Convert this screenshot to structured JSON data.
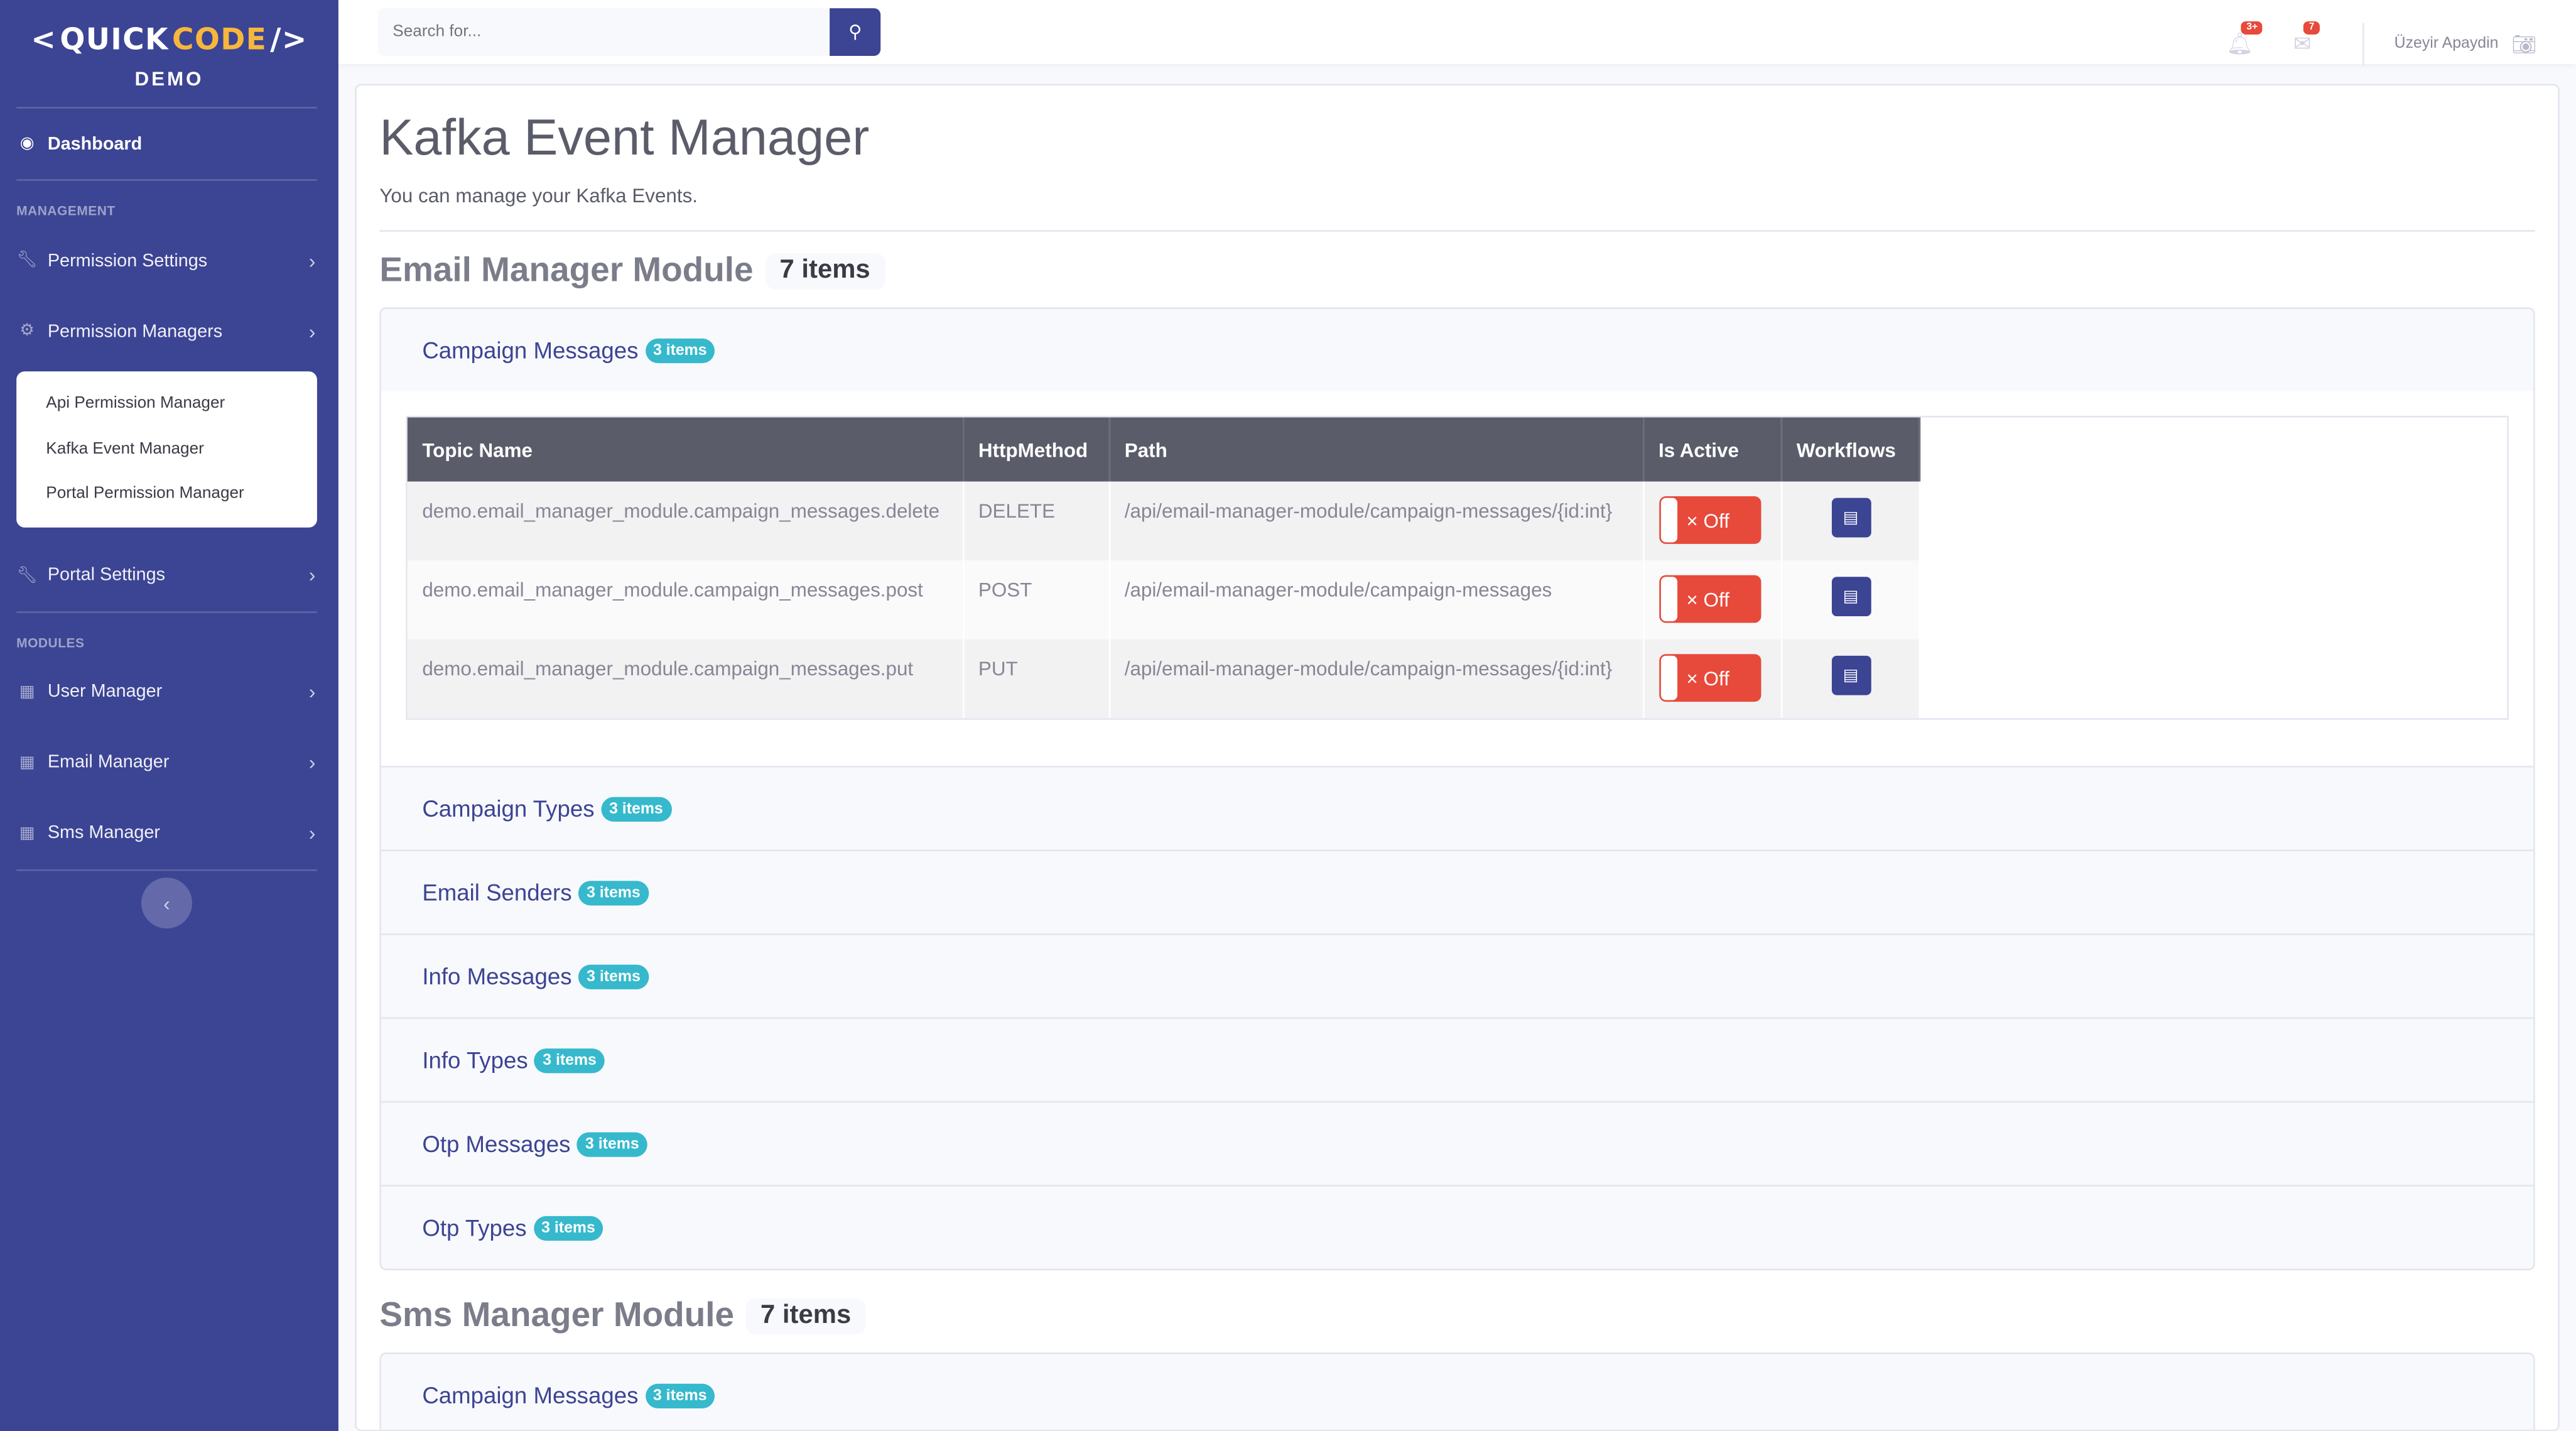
{
  "brand": {
    "left": "<",
    "quick": "QUICK",
    "code": "CODE",
    "right": "/>",
    "sub": "DEMO"
  },
  "sidebar": {
    "dashboard": "Dashboard",
    "heading_management": "MANAGEMENT",
    "permission_settings": "Permission Settings",
    "permission_managers": "Permission Managers",
    "submenu": [
      "Api Permission Manager",
      "Kafka Event Manager",
      "Portal Permission Manager"
    ],
    "portal_settings": "Portal Settings",
    "heading_modules": "MODULES",
    "user_manager": "User Manager",
    "email_manager": "Email Manager",
    "sms_manager": "Sms Manager"
  },
  "topbar": {
    "search_placeholder": "Search for...",
    "alerts_count": "3+",
    "messages_count": "7",
    "user_name": "Üzeyir Apaydin"
  },
  "page": {
    "title": "Kafka Event Manager",
    "subtitle": "You can manage your Kafka Events."
  },
  "modules": [
    {
      "title": "Email Manager Module",
      "count": "7 items",
      "groups": [
        {
          "name": "Campaign Messages",
          "count": "3 items",
          "expanded": true,
          "columns": [
            "Topic Name",
            "HttpMethod",
            "Path",
            "Is Active",
            "Workflows"
          ],
          "rows": [
            {
              "topic": "demo.email_manager_module.campaign_messages.delete",
              "method": "DELETE",
              "path": "/api/email-manager-module/campaign-messages/{id:int}",
              "active": "Off"
            },
            {
              "topic": "demo.email_manager_module.campaign_messages.post",
              "method": "POST",
              "path": "/api/email-manager-module/campaign-messages",
              "active": "Off"
            },
            {
              "topic": "demo.email_manager_module.campaign_messages.put",
              "method": "PUT",
              "path": "/api/email-manager-module/campaign-messages/{id:int}",
              "active": "Off"
            }
          ]
        },
        {
          "name": "Campaign Types",
          "count": "3 items"
        },
        {
          "name": "Email Senders",
          "count": "3 items"
        },
        {
          "name": "Info Messages",
          "count": "3 items"
        },
        {
          "name": "Info Types",
          "count": "3 items"
        },
        {
          "name": "Otp Messages",
          "count": "3 items"
        },
        {
          "name": "Otp Types",
          "count": "3 items"
        }
      ]
    },
    {
      "title": "Sms Manager Module",
      "count": "7 items",
      "groups": [
        {
          "name": "Campaign Messages",
          "count": "3 items"
        }
      ]
    }
  ],
  "colors": {
    "sidebar": "#3c4494",
    "accent": "#3c4494",
    "pill": "#36b9cc",
    "off": "#e74a3b",
    "brand_code": "#f6b73c"
  },
  "icons": {
    "toggle_off": "×",
    "workflow": "list-icon"
  }
}
